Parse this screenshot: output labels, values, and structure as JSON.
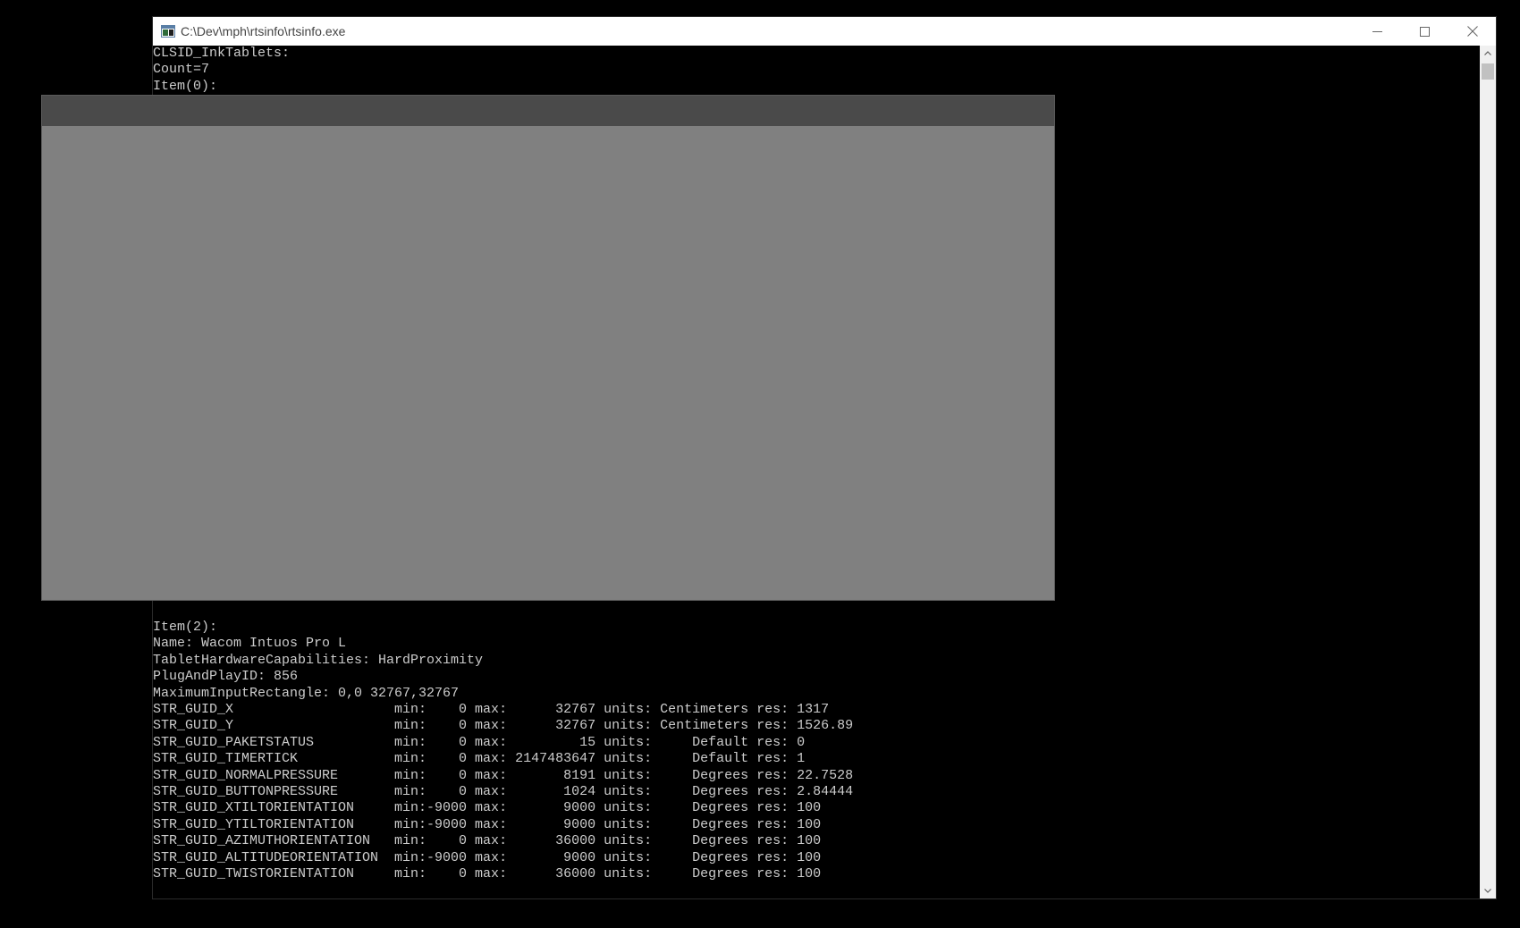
{
  "window": {
    "title": "C:\\Dev\\mph\\rtsinfo\\rtsinfo.exe",
    "controls": {
      "minimize": "minimize-icon",
      "maximize": "maximize-icon",
      "close": "close-icon"
    }
  },
  "console": {
    "header_lines": [
      "CLSID_InkTablets:",
      "Count=7",
      "Item(0):"
    ],
    "item_lines": [
      "Item(2):",
      "Name: Wacom Intuos Pro L",
      "TabletHardwareCapabilities: HardProximity",
      "PlugAndPlayID: 856",
      "MaximumInputRectangle: 0,0 32767,32767",
      "STR_GUID_X                    min:    0 max:      32767 units: Centimeters res: 1317",
      "STR_GUID_Y                    min:    0 max:      32767 units: Centimeters res: 1526.89",
      "STR_GUID_PAKETSTATUS          min:    0 max:         15 units:     Default res: 0",
      "STR_GUID_TIMERTICK            min:    0 max: 2147483647 units:     Default res: 1",
      "STR_GUID_NORMALPRESSURE       min:    0 max:       8191 units:     Degrees res: 22.7528",
      "STR_GUID_BUTTONPRESSURE       min:    0 max:       1024 units:     Degrees res: 2.84444",
      "STR_GUID_XTILTORIENTATION     min:-9000 max:       9000 units:     Degrees res: 100",
      "STR_GUID_YTILTORIENTATION     min:-9000 max:       9000 units:     Degrees res: 100",
      "STR_GUID_AZIMUTHORIENTATION   min:    0 max:      36000 units:     Degrees res: 100",
      "STR_GUID_ALTITUDEORIENTATION  min:-9000 max:       9000 units:     Degrees res: 100",
      "STR_GUID_TWISTORIENTATION     min:    0 max:      36000 units:     Degrees res: 100"
    ]
  },
  "scrollbar": {
    "up": "scroll-up-arrow-icon",
    "down": "scroll-down-arrow-icon"
  },
  "colors": {
    "console_bg": "#000000",
    "console_text": "#cccccc",
    "overlay": "#808080",
    "overlay_header": "#4a4a4a"
  }
}
